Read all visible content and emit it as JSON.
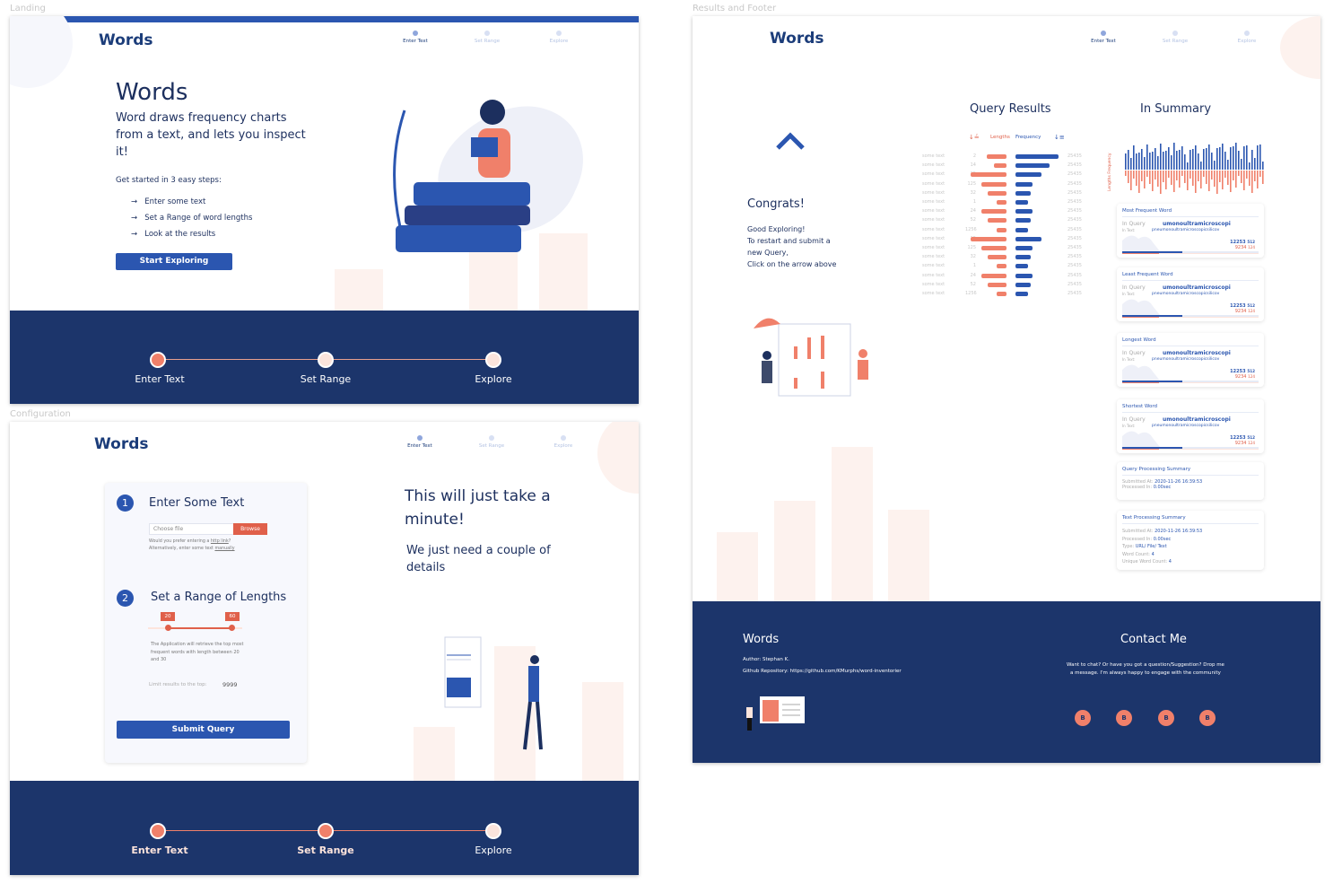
{
  "labels": {
    "landing": "Landing",
    "configuration": "Configuration",
    "results": "Results and Footer"
  },
  "brand": "Words",
  "steps": [
    "Enter Text",
    "Set Range",
    "Explore"
  ],
  "landing": {
    "title": "Words",
    "intro": "Word draws frequency charts from a text, and lets you inspect it!",
    "get_started": "Get started in 3 easy steps:",
    "list": [
      "Enter some text",
      "Set a Range of word lengths",
      "Look at the results"
    ],
    "cta": "Start Exploring"
  },
  "config": {
    "step1_num": "1",
    "step1_title": "Enter Some Text",
    "file_placeholder": "Choose file",
    "browse": "Browse",
    "hint1": "Would you prefer entering a ",
    "hint1_link": "http link",
    "hint1_end": "?",
    "hint2": "Alternatively, enter some text ",
    "hint2_link": "manually",
    "step2_num": "2",
    "step2_title": "Set a Range of Lengths",
    "range_min": "20",
    "range_max": "60",
    "range_desc": "The Application will retrieve the top most frequent words with length between 20 and 30",
    "limit_label": "Limit results to the top:",
    "limit_value": "9999",
    "submit": "Submit Query",
    "headline": "This will just take a minute!",
    "subline": "We just need a couple of details"
  },
  "results": {
    "congrats": "Congrats!",
    "msg": [
      "Good Exploring!",
      "To restart and submit a",
      "new Query,",
      "Click on the arrow above"
    ],
    "query_title": "Query Results",
    "sort_lengths": "Lengths",
    "sort_frequency": "Frequency",
    "rows": [
      {
        "word": "some text",
        "length": "2",
        "lbar": 0.45,
        "fbar": 0.95,
        "freq": "25435"
      },
      {
        "word": "some text",
        "length": "14",
        "lbar": 0.28,
        "fbar": 0.75,
        "freq": "25435"
      },
      {
        "word": "some text",
        "length": "15",
        "lbar": 0.8,
        "fbar": 0.58,
        "freq": "25435"
      },
      {
        "word": "some text",
        "length": "125",
        "lbar": 0.57,
        "fbar": 0.37,
        "freq": "25435"
      },
      {
        "word": "some text",
        "length": "32",
        "lbar": 0.42,
        "fbar": 0.33,
        "freq": "25435"
      },
      {
        "word": "some text",
        "length": "1",
        "lbar": 0.23,
        "fbar": 0.27,
        "freq": "25435"
      },
      {
        "word": "some text",
        "length": "24",
        "lbar": 0.57,
        "fbar": 0.37,
        "freq": "25435"
      },
      {
        "word": "some text",
        "length": "52",
        "lbar": 0.42,
        "fbar": 0.33,
        "freq": "25435"
      },
      {
        "word": "some text",
        "length": "1256",
        "lbar": 0.23,
        "fbar": 0.27,
        "freq": "25435"
      },
      {
        "word": "some text",
        "length": "15",
        "lbar": 0.8,
        "fbar": 0.58,
        "freq": "25435"
      },
      {
        "word": "some text",
        "length": "125",
        "lbar": 0.57,
        "fbar": 0.37,
        "freq": "25435"
      },
      {
        "word": "some text",
        "length": "32",
        "lbar": 0.42,
        "fbar": 0.33,
        "freq": "25435"
      },
      {
        "word": "some text",
        "length": "1",
        "lbar": 0.23,
        "fbar": 0.27,
        "freq": "25435"
      },
      {
        "word": "some text",
        "length": "24",
        "lbar": 0.57,
        "fbar": 0.37,
        "freq": "25435"
      },
      {
        "word": "some text",
        "length": "52",
        "lbar": 0.42,
        "fbar": 0.33,
        "freq": "25435"
      },
      {
        "word": "some text",
        "length": "1256",
        "lbar": 0.23,
        "fbar": 0.27,
        "freq": "25435"
      }
    ],
    "summary_title": "In Summary",
    "summary_axis": "Lengths  Frequency",
    "word_cards": [
      {
        "title": "Most Frequent Word"
      },
      {
        "title": "Least Frequent Word"
      },
      {
        "title": "Longest Word"
      },
      {
        "title": "Shortest Word"
      }
    ],
    "card_in_query": "In Query",
    "card_in_text": "In Text:",
    "card_word": "umonoultramicroscopi",
    "card_text_word": "pneumonoultramicroscopicsilicov",
    "card_n1": "12253",
    "card_n1s": "512",
    "card_n2": "9234",
    "card_n2s": "124",
    "query_summary": {
      "title": "Query Processing Summary",
      "submitted_label": "Submitted At: ",
      "submitted": "2020-11-26 16:39:53",
      "processed_label": "Processed In: ",
      "processed": "0.00sec"
    },
    "text_summary": {
      "title": "Text Processing Summary",
      "submitted_label": "Submitted At: ",
      "submitted": "2020-11-26 16:39:53",
      "processed_label": "Processed In: ",
      "processed": "0.00sec",
      "type_label": "Type: ",
      "type": "URL/ File/ Text",
      "wc_label": "Word Count: ",
      "wc": "4",
      "uwc_label": "Unique Word Count: ",
      "uwc": "4"
    }
  },
  "footer": {
    "brand": "Words",
    "author": "Author: Stephan K.",
    "repo": "Github Repository: https://github.com/KMurphs/word-inventorier",
    "contact_title": "Contact Me",
    "contact_text": "Want to chat? Or have you got a question/Suggestion? Drop me a message. I'm always happy to engage with the community",
    "social_icons": [
      "B",
      "B",
      "B",
      "B"
    ]
  },
  "colors": {
    "navy": "#1c356b",
    "blue": "#2b56b0",
    "salmon": "#f0806a"
  }
}
